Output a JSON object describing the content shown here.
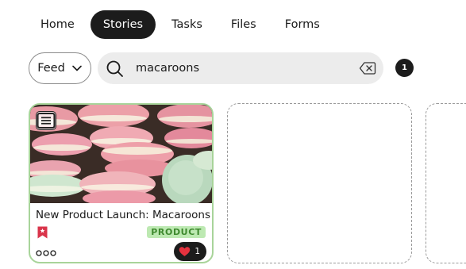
{
  "nav": {
    "tabs": [
      {
        "label": "Home"
      },
      {
        "label": "Stories"
      },
      {
        "label": "Tasks"
      },
      {
        "label": "Files"
      },
      {
        "label": "Forms"
      }
    ],
    "active": "Stories"
  },
  "filter": {
    "feed_label": "Feed",
    "feed_icon": "chevron-down-icon"
  },
  "search": {
    "value": "macaroons",
    "icon": "search-icon",
    "clear_icon": "backspace-clear-icon"
  },
  "results_count": "1",
  "cards": [
    {
      "title": "New Product Launch: Macaroons",
      "tag": "PRODUCT",
      "likes": "1",
      "type_icon": "article-icon",
      "image": "macaroons-photo",
      "bookmark_icon": "starred-bookmark-icon",
      "more_icon": "more-dots-icon",
      "like_icon": "heart-icon"
    }
  ],
  "colors": {
    "nav_active_bg": "#1c1c1c",
    "card_border": "#a8d49a",
    "tag_bg": "#bde9b2",
    "tag_text": "#3f8a2f",
    "heart": "#e5323e",
    "bookmark": "#d9344a"
  }
}
